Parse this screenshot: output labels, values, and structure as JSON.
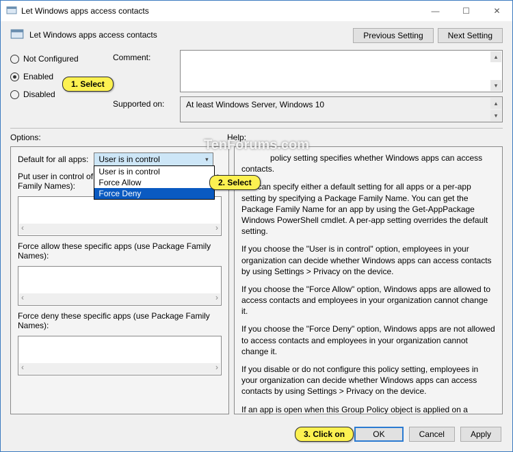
{
  "window": {
    "title": "Let Windows apps access contacts"
  },
  "subtitle": "Let Windows apps access contacts",
  "nav": {
    "prev": "Previous Setting",
    "next": "Next Setting"
  },
  "radios": {
    "not_configured": "Not Configured",
    "enabled": "Enabled",
    "disabled": "Disabled"
  },
  "fields": {
    "comment_label": "Comment:",
    "supported_label": "Supported on:",
    "supported_value": "At least Windows Server, Windows 10"
  },
  "labels": {
    "options": "Options:",
    "help": "Help:"
  },
  "options": {
    "default_label": "Default for all apps:",
    "combo_selected": "User is in control",
    "combo_items": {
      "a": "User is in control",
      "b": "Force Allow",
      "c": "Force Deny"
    },
    "user_control_label": "Put user in control of these specific apps (use Package Family Names):",
    "user_control_label_trunc": "Put user in control of",
    "user_control_label_trunc2": "Family Names):",
    "user_control_label_covered": "age",
    "force_allow_label": "Force allow these specific apps (use Package Family Names):",
    "force_deny_label": "Force deny these specific apps (use Package Family Names):"
  },
  "help": {
    "p1": "This policy setting specifies whether Windows apps can access contacts.",
    "p1_visible": "policy setting specifies whether Windows apps can access contacts.",
    "p2": "You can specify either a default setting for all apps or a per-app setting by specifying a Package Family Name. You can get the Package Family Name for an app by using the Get-AppPackage Windows PowerShell cmdlet. A per-app setting overrides the default setting.",
    "p3": "If you choose the \"User is in control\" option, employees in your organization can decide whether Windows apps can access contacts by using Settings > Privacy on the device.",
    "p4": "If you choose the \"Force Allow\" option, Windows apps are allowed to access contacts and employees in your organization cannot change it.",
    "p5": "If you choose the \"Force Deny\" option, Windows apps are not allowed to access contacts and employees in your organization cannot change it.",
    "p6": "If you disable or do not configure this policy setting, employees in your organization can decide whether Windows apps can access contacts by using Settings > Privacy on the device.",
    "p7": "If an app is open when this Group Policy object is applied on a device, employees must restart the app or device for the policy changes to be applied to the app."
  },
  "buttons": {
    "ok": "OK",
    "cancel": "Cancel",
    "apply": "Apply"
  },
  "callouts": {
    "c1": "1.  Select",
    "c2": "2.  Select",
    "c3": "3.  Click on"
  },
  "watermark": "TenForums.com"
}
